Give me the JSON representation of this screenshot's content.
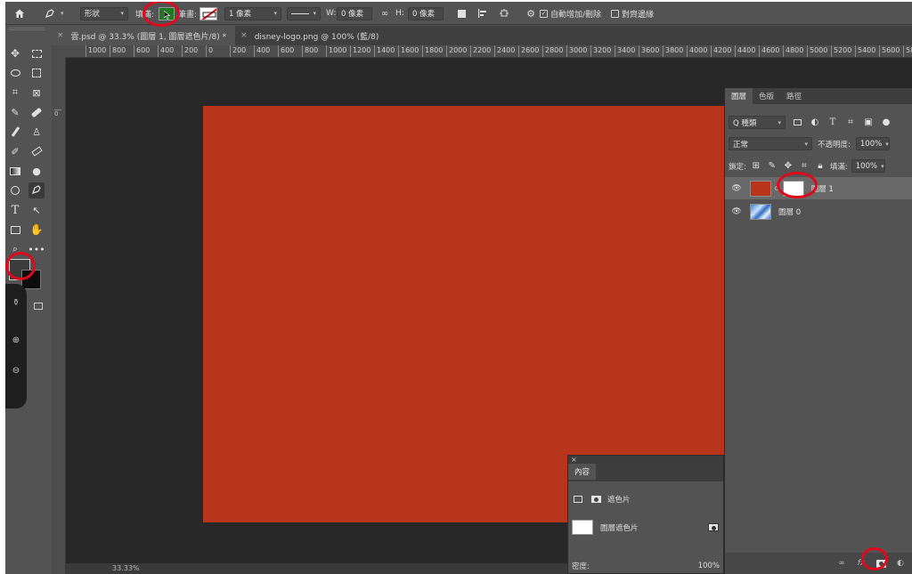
{
  "options_bar": {
    "mode": "形狀",
    "fill_label": "填滿:",
    "stroke_label": "筆畫:",
    "stroke_width": "1 像素",
    "w_label": "W:",
    "w_value": "0 像素",
    "h_label": "H:",
    "h_value": "0 像素",
    "auto_add_delete": "自動增加/刪除",
    "align_edges": "對齊邊緣"
  },
  "tabs": [
    {
      "label": "雲.psd @ 33.3% (圖層 1, 圖層遮色片/8) *",
      "close": "×"
    },
    {
      "label": "disney-logo.png @ 100% (藍/8)",
      "close": "×"
    }
  ],
  "ruler_ticks": [
    "1000",
    "800",
    "600",
    "400",
    "200",
    "0",
    "200",
    "400",
    "600",
    "800",
    "1000",
    "1200",
    "1400",
    "1600",
    "1800",
    "2000",
    "2200",
    "2400",
    "2600",
    "2800",
    "3000",
    "3200",
    "3400",
    "3600",
    "3800",
    "4000",
    "4200",
    "4400",
    "4600",
    "4800",
    "5000",
    "5200",
    "5400",
    "5600",
    "58"
  ],
  "vruler_ticks": [
    "0"
  ],
  "layers_panel": {
    "tabs": [
      "圖層",
      "色版",
      "路徑"
    ],
    "filter": "Q 種類",
    "blend_mode": "正常",
    "opacity_label": "不透明度:",
    "opacity_value": "100%",
    "lock_label": "鎖定:",
    "fill_label": "填滿:",
    "fill_value": "100%",
    "layers": [
      {
        "name": "圖層 1",
        "active": true
      },
      {
        "name": "圖層 0",
        "active": false
      }
    ]
  },
  "properties_panel": {
    "close": "×",
    "title": "內容",
    "section": "遮色片",
    "mask_label": "圖層遮色片",
    "density_label": "密度:",
    "density_value": "100%"
  },
  "status": "33.33%",
  "colors": {
    "canvas_fill": "#b8341b",
    "fill_swatch": "#1f7a1f",
    "annotation": "#e1081b"
  }
}
